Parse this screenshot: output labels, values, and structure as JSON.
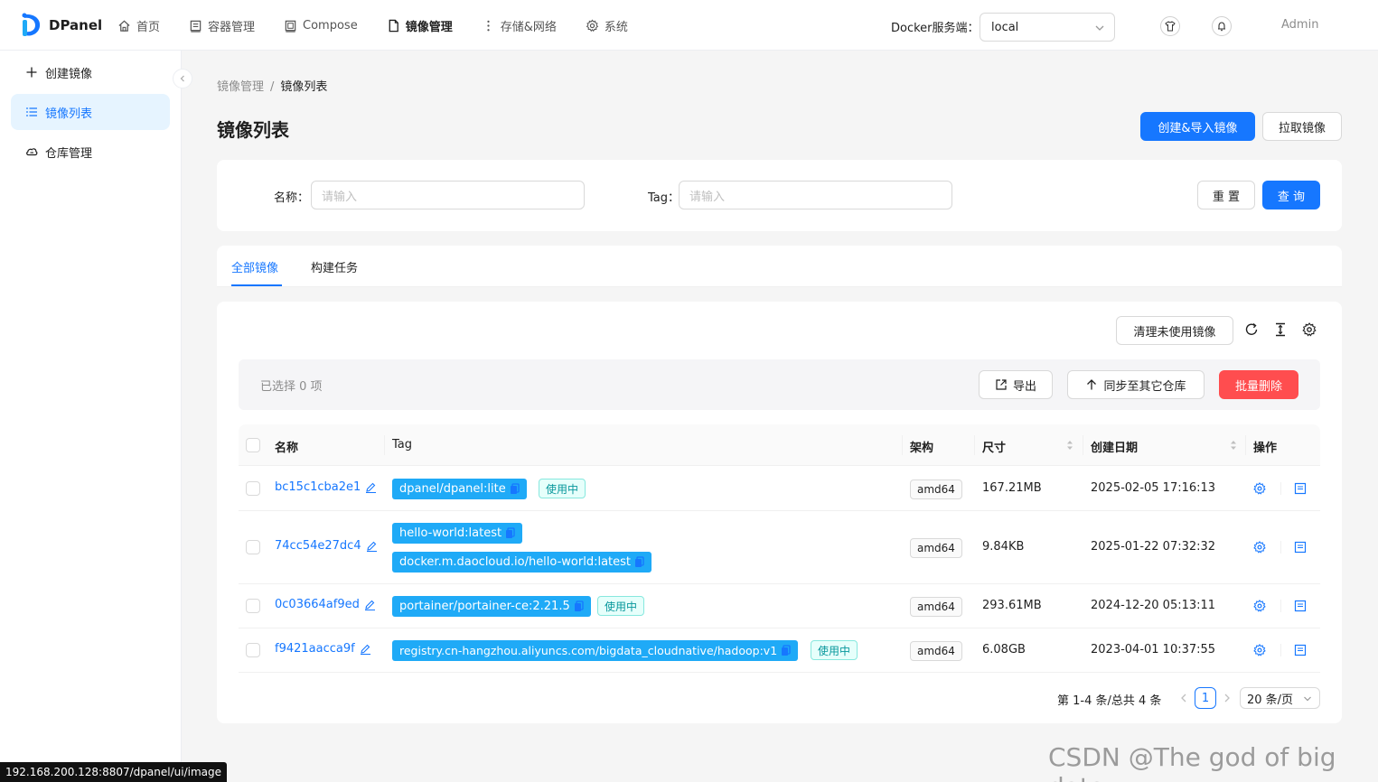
{
  "header": {
    "app_name": "DPanel",
    "nav": [
      {
        "label": "首页",
        "icon": "home-icon"
      },
      {
        "label": "容器管理",
        "icon": "container-icon"
      },
      {
        "label": "Compose",
        "icon": "compose-icon"
      },
      {
        "label": "镜像管理",
        "icon": "image-icon",
        "active": true
      },
      {
        "label": "存储&网络",
        "icon": "storage-icon"
      },
      {
        "label": "系统",
        "icon": "gear-icon"
      }
    ],
    "docker_label": "Docker服务端：",
    "docker_value": "local",
    "user": "Admin"
  },
  "sidebar": {
    "items": [
      {
        "label": "创建镜像",
        "icon": "plus-icon"
      },
      {
        "label": "镜像列表",
        "icon": "list-icon",
        "active": true
      },
      {
        "label": "仓库管理",
        "icon": "cloud-icon"
      }
    ]
  },
  "breadcrumb": {
    "parent": "镜像管理",
    "sep": "/",
    "current": "镜像列表"
  },
  "page": {
    "title": "镜像列表",
    "create_import_button": "创建&导入镜像",
    "pull_button": "拉取镜像"
  },
  "search": {
    "name_label": "名称：",
    "name_placeholder": "请输入",
    "tag_label": "Tag：",
    "tag_placeholder": "请输入",
    "reset_button": "重 置",
    "query_button": "查 询"
  },
  "tabs": [
    {
      "label": "全部镜像",
      "active": true
    },
    {
      "label": "构建任务"
    }
  ],
  "toolbar": {
    "prune_button": "清理未使用镜像"
  },
  "selection": {
    "text": "已选择  0  项",
    "export_button": "导出",
    "sync_button": "同步至其它仓库",
    "batch_delete_button": "批量删除"
  },
  "table": {
    "columns": [
      "名称",
      "Tag",
      "架构",
      "尺寸",
      "创建日期",
      "操作"
    ],
    "rows": [
      {
        "name": "bc15c1cba2e1",
        "tags": [
          "dpanel/dpanel:lite"
        ],
        "in_use": "使用中",
        "arch": "amd64",
        "size": "167.21MB",
        "created": "2025-02-05 17:16:13"
      },
      {
        "name": "74cc54e27dc4",
        "tags": [
          "hello-world:latest",
          "docker.m.daocloud.io/hello-world:latest"
        ],
        "in_use": "",
        "arch": "amd64",
        "size": "9.84KB",
        "created": "2025-01-22 07:32:32"
      },
      {
        "name": "0c03664af9ed",
        "tags": [
          "portainer/portainer-ce:2.21.5"
        ],
        "in_use": "使用中",
        "arch": "amd64",
        "size": "293.61MB",
        "created": "2024-12-20 05:13:11"
      },
      {
        "name": "f9421aacca9f",
        "tags": [
          "registry.cn-hangzhou.aliyuncs.com/bigdata_cloudnative/hadoop:v1"
        ],
        "in_use": "使用中",
        "arch": "amd64",
        "size": "6.08GB",
        "created": "2023-04-01 10:37:55"
      }
    ]
  },
  "pagination": {
    "summary": "第 1-4 条/总共 4 条",
    "current": "1",
    "page_size": "20 条/页"
  },
  "status_url": "192.168.200.128:8807/dpanel/ui/image",
  "watermark": "CSDN @The god of big data",
  "colors": {
    "primary": "#1677ff",
    "danger": "#ff4d4f",
    "tag_bg": "#1faaf7",
    "inuse": "#08979c"
  }
}
